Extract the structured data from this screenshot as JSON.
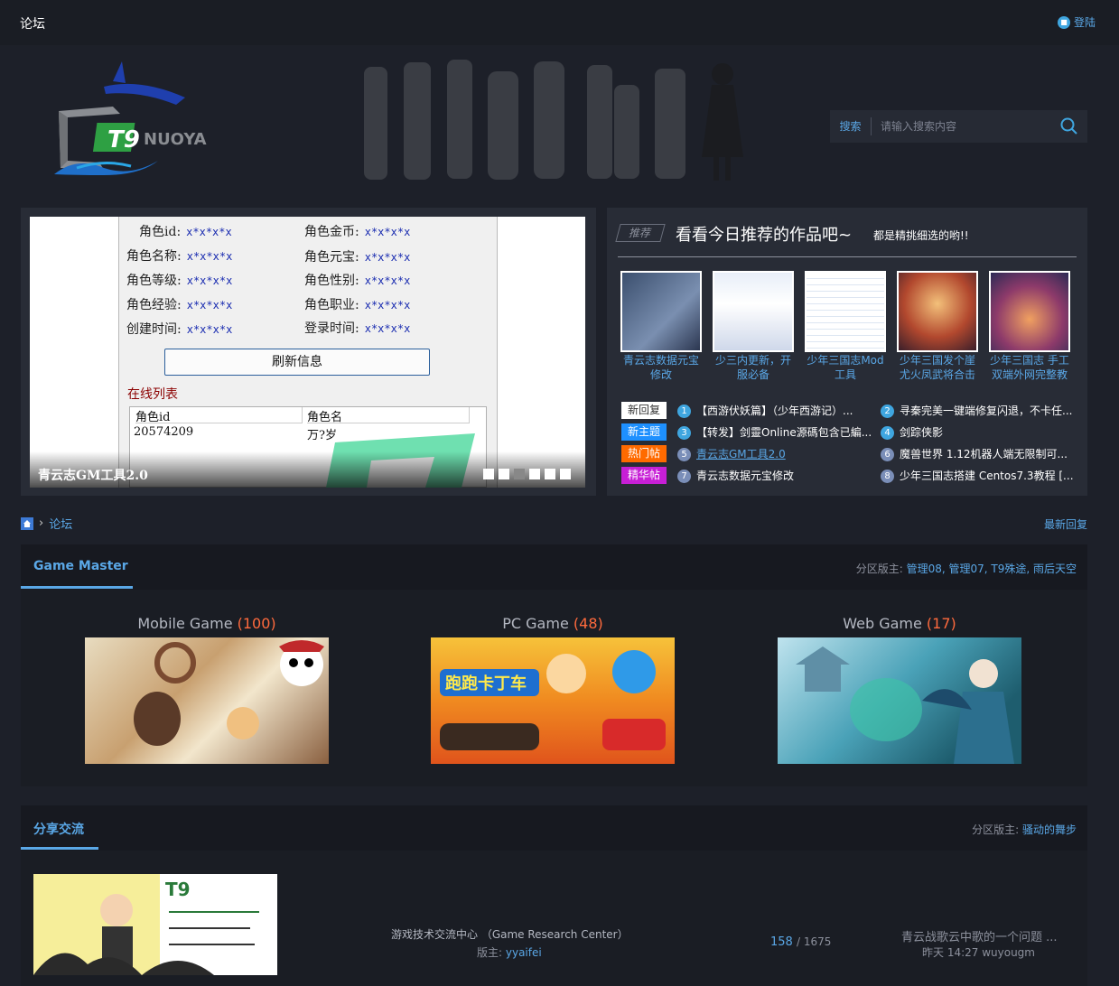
{
  "topbar": {
    "brand": "论坛",
    "login": "登陆"
  },
  "header": {
    "logo_text": "NUOYA",
    "logo_mark": "T9",
    "search": {
      "label": "搜索",
      "placeholder": "请输入搜索内容"
    }
  },
  "slider": {
    "fields": [
      {
        "label": "角色id:",
        "value": "x*x*x*x"
      },
      {
        "label": "角色金币:",
        "value": "x*x*x*x"
      },
      {
        "label": "角色名称:",
        "value": "x*x*x*x"
      },
      {
        "label": "角色元宝:",
        "value": "x*x*x*x"
      },
      {
        "label": "角色等级:",
        "value": "x*x*x*x"
      },
      {
        "label": "角色性别:",
        "value": "x*x*x*x"
      },
      {
        "label": "角色经验:",
        "value": "x*x*x*x"
      },
      {
        "label": "角色职业:",
        "value": "x*x*x*x"
      },
      {
        "label": "创建时间:",
        "value": "x*x*x*x"
      },
      {
        "label": "登录时间:",
        "value": "x*x*x*x"
      }
    ],
    "refresh_label": "刷新信息",
    "online_label": "在线列表",
    "table_headers": [
      "角色id",
      "角色名"
    ],
    "table_row": [
      "20574209",
      "万?岁"
    ],
    "caption": "青云志GM工具2.0",
    "active_dot": 3
  },
  "recommend": {
    "tag": "推荐",
    "title": "看看今日推荐的作品吧~",
    "subtitle": "都是精挑细选的哟!!",
    "thumbs": [
      {
        "caption": "青云志数据元宝修改"
      },
      {
        "caption": "少三内更新，开服必备"
      },
      {
        "caption": "少年三国志Mod工具"
      },
      {
        "caption": "少年三国发个崖尤火凤武将合击"
      },
      {
        "caption": "少年三国志 手工双端外网完整教"
      }
    ],
    "badges": [
      {
        "label": "新回复",
        "color": "#ffffff",
        "text": "#333333"
      },
      {
        "label": "新主题",
        "color": "#1e90ff",
        "text": "#ffffff"
      },
      {
        "label": "热门帖",
        "color": "#ff6a00",
        "text": "#ffffff"
      },
      {
        "label": "精华帖",
        "color": "#c71fd6",
        "text": "#ffffff"
      }
    ],
    "items": [
      {
        "n": "1",
        "text": "【西游伏妖篇】（少年西游记）..."
      },
      {
        "n": "2",
        "text": "寻秦完美一键端修复闪退，不卡任..."
      },
      {
        "n": "3",
        "text": "【转发】剑靈Online源碼包含已編..."
      },
      {
        "n": "4",
        "text": "剑踪侠影"
      },
      {
        "n": "5",
        "text": "青云志GM工具2.0"
      },
      {
        "n": "6",
        "text": "魔兽世界 1.12机器人端无限制可..."
      },
      {
        "n": "7",
        "text": "青云志数据元宝修改"
      },
      {
        "n": "8",
        "text": "少年三国志搭建 Centos7.3教程 [..."
      }
    ]
  },
  "breadcrumb": {
    "current": "论坛",
    "latest": "最新回复"
  },
  "section1": {
    "name": "Game Master",
    "mod_label": "分区版主:",
    "mods": "管理08, 管理07, T9殊途, 雨后天空",
    "games": [
      {
        "name": "Mobile Game",
        "count": "(100)"
      },
      {
        "name": "PC Game",
        "count": "(48)"
      },
      {
        "name": "Web Game",
        "count": "(17)"
      }
    ]
  },
  "section2": {
    "name": "分享交流",
    "mod_label": "分区版主:",
    "mods": "骚动的舞步",
    "forum": {
      "title": "游戏技术交流中心 （Game Research Center）",
      "mod_label": "版主:",
      "mod": "yyaifei",
      "threads": "158",
      "posts": "/ 1675",
      "last_title": "青云战歌云中歌的一个问题 ...",
      "last_meta": "昨天 14:27 wuyougm"
    }
  }
}
